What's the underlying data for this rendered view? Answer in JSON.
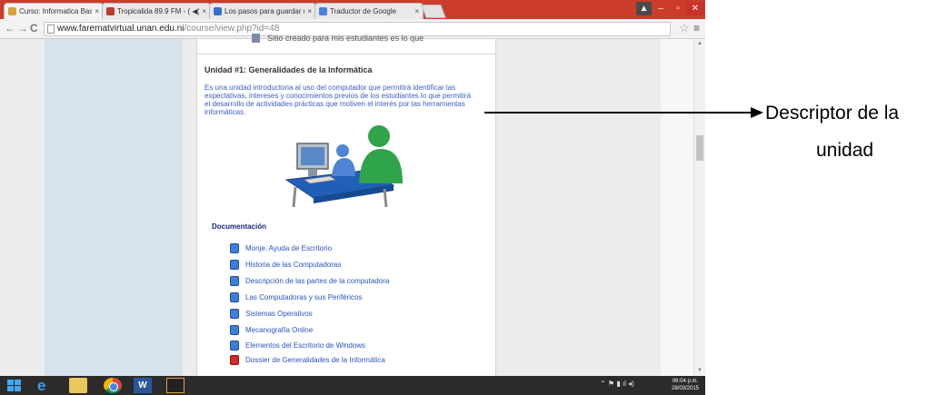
{
  "browser": {
    "tabs": [
      {
        "label": "Curso: Informatica Basica",
        "color": "#d7a23a",
        "active": true
      },
      {
        "label": "Tropicalida 89.9 FM - ( ◀)",
        "color": "#c0392b",
        "active": false
      },
      {
        "label": "Los pasos para guardar u",
        "color": "#3b6fc9",
        "active": false
      },
      {
        "label": "Traductor de Google",
        "color": "#4a7fe0",
        "active": false
      }
    ],
    "address": {
      "host": "www.farematvirtual.unan.edu.ni",
      "path": "/course/view.php?id=48"
    },
    "nav": {
      "back": "←",
      "forward": "→",
      "reload": "C"
    }
  },
  "course": {
    "previous_item": "Sitio creado para mis estudiantes es lo que",
    "unit_title": "Unidad #1: Generalidades de la Informática",
    "unit_description": "Es una unidad introductoria al uso del computador que permitirá identificar las expectativas, intereses y conocimientos previos de los estudiantes lo que permitirá el desarrollo de actividades prácticas que motiven el interés por las herramientas informáticas.",
    "section_heading": "Documentación",
    "resources": [
      {
        "label": "Monje. Ayuda de Escritorio",
        "icon": "document-icon"
      },
      {
        "label": "Historia de las Computadoras",
        "icon": "document-icon"
      },
      {
        "label": "Descripción de las partes de la computadora",
        "icon": "document-icon"
      },
      {
        "label": "Las Computadoras y sus Periféricos",
        "icon": "document-icon"
      },
      {
        "label": "Sistemas Operativos",
        "icon": "document-icon"
      },
      {
        "label": "Mecanografía Online",
        "icon": "document-icon"
      },
      {
        "label": "Elementos del Escritorio de Windows",
        "icon": "document-icon"
      },
      {
        "label": "Dossier de Generalidades de la Informática",
        "icon": "pdf-icon"
      }
    ]
  },
  "taskbar": {
    "clock_time": "06:04 p.m.",
    "clock_date": "28/03/2015"
  },
  "annotation": {
    "line1": "Descriptor de la",
    "line2": "unidad"
  },
  "colors": {
    "link_blue": "#2d51c2",
    "description_blue": "#3b5dc9",
    "heading_navy": "#1a237e",
    "sidebar_blue": "#d6e3ea"
  }
}
